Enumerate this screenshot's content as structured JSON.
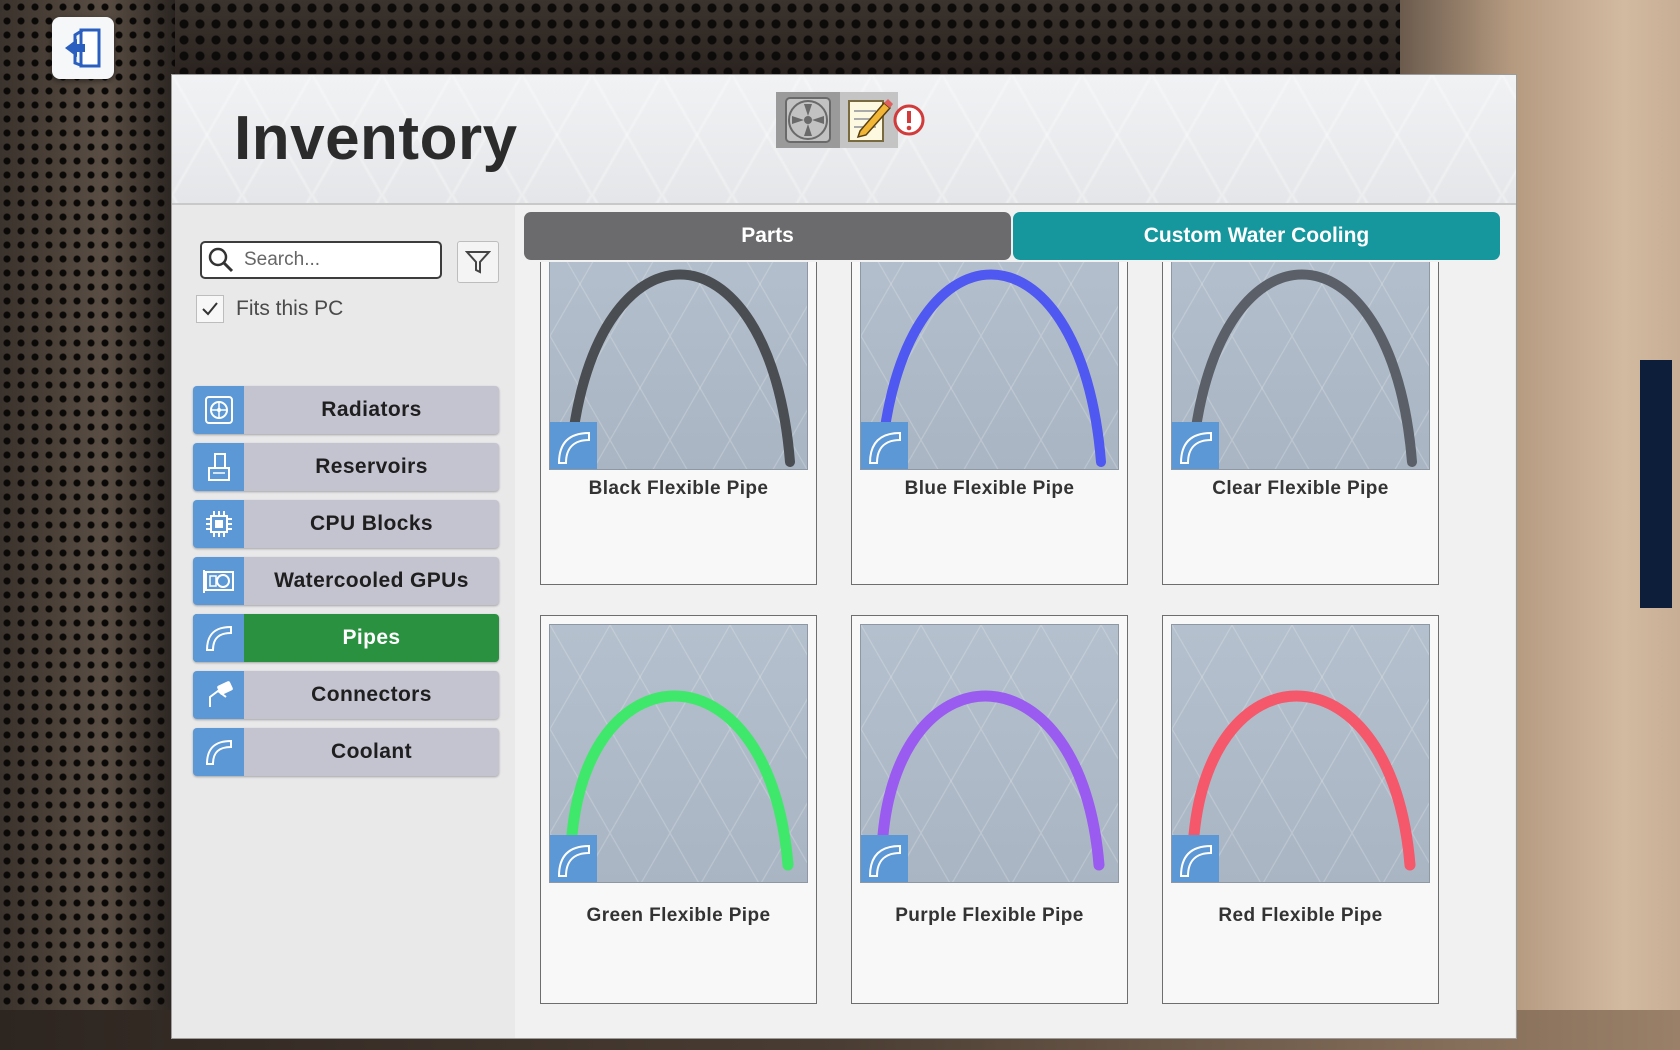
{
  "title": "Inventory",
  "search": {
    "placeholder": "Search..."
  },
  "filters": {
    "fits_this_pc_label": "Fits this PC",
    "fits_this_pc_checked": true
  },
  "categories": [
    {
      "label": "Radiators",
      "icon": "radiator-icon",
      "active": false
    },
    {
      "label": "Reservoirs",
      "icon": "reservoir-icon",
      "active": false
    },
    {
      "label": "CPU Blocks",
      "icon": "cpu-block-icon",
      "active": false
    },
    {
      "label": "Watercooled GPUs",
      "icon": "gpu-icon",
      "active": false
    },
    {
      "label": "Pipes",
      "icon": "pipe-icon",
      "active": true
    },
    {
      "label": "Connectors",
      "icon": "connector-icon",
      "active": false
    },
    {
      "label": "Coolant",
      "icon": "coolant-icon",
      "active": false
    }
  ],
  "tabs": [
    {
      "label": "Parts",
      "active": false
    },
    {
      "label": "Custom Water Cooling",
      "active": true
    }
  ],
  "items": [
    {
      "name": "Black Flexible Pipe",
      "color": "#4a4d52"
    },
    {
      "name": "Blue Flexible Pipe",
      "color": "#4f58f0"
    },
    {
      "name": "Clear Flexible Pipe",
      "color": "#5b6068"
    },
    {
      "name": "Green Flexible Pipe",
      "color": "#3fe86a"
    },
    {
      "name": "Purple Flexible Pipe",
      "color": "#9a5cf0"
    },
    {
      "name": "Red Flexible Pipe",
      "color": "#f4586a"
    }
  ],
  "colors": {
    "active_category": "#2a9140",
    "active_tab": "#16979d",
    "inactive_tab": "#6b6b6e",
    "category_icon_bg": "#5c98d6",
    "scrollbar": "#0d1e3b"
  }
}
